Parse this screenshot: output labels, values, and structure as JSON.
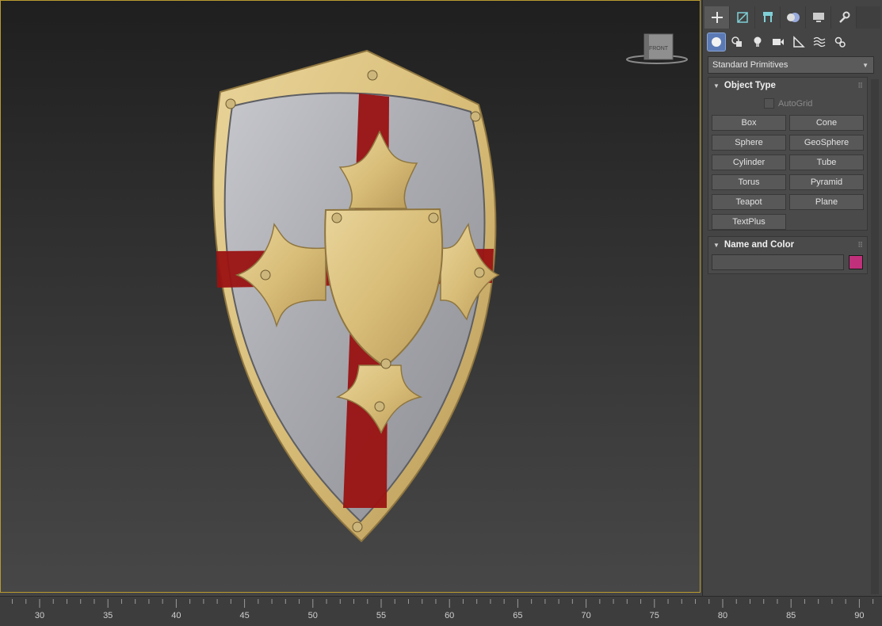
{
  "command_panel": {
    "tabs": [
      {
        "name": "create-icon",
        "active": true
      },
      {
        "name": "modify-icon",
        "active": false
      },
      {
        "name": "hierarchy-icon",
        "active": false
      },
      {
        "name": "motion-icon",
        "active": false
      },
      {
        "name": "display-icon",
        "active": false
      },
      {
        "name": "utilities-icon",
        "active": false
      }
    ],
    "subtabs": [
      "geometry-icon",
      "shapes-icon",
      "lights-icon",
      "cameras-icon",
      "helpers-icon",
      "spacewarps-icon",
      "systems-icon"
    ],
    "category_dropdown": "Standard Primitives",
    "object_type": {
      "title": "Object Type",
      "autogrid_label": "AutoGrid",
      "buttons": [
        "Box",
        "Cone",
        "Sphere",
        "GeoSphere",
        "Cylinder",
        "Tube",
        "Torus",
        "Pyramid",
        "Teapot",
        "Plane",
        "TextPlus"
      ]
    },
    "name_and_color": {
      "title": "Name and Color",
      "name_value": "",
      "swatch_color": "#c1307a"
    }
  },
  "viewport": {
    "viewcube_label": "FRONT",
    "border_color": "#b99a2f"
  },
  "timeline": {
    "ticks": [
      "30",
      "35",
      "40",
      "45",
      "50",
      "55",
      "60",
      "65",
      "70",
      "75",
      "80",
      "85",
      "90"
    ]
  }
}
